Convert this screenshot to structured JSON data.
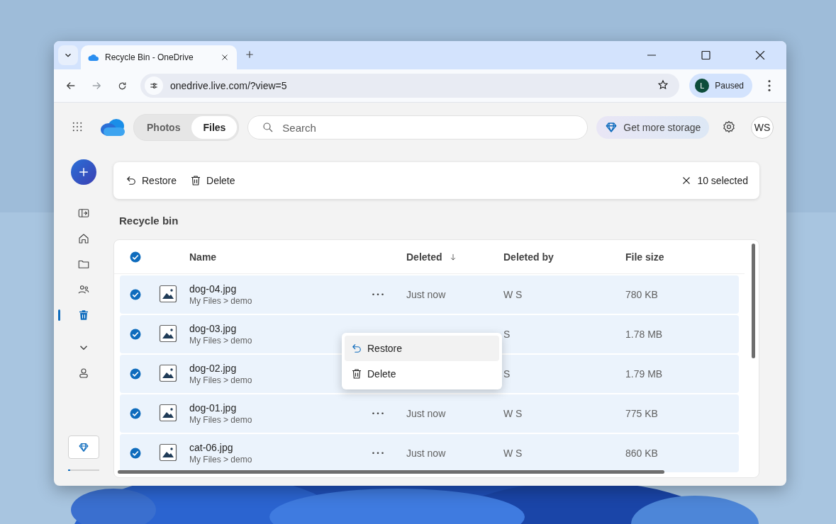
{
  "browser": {
    "tab": {
      "title": "Recycle Bin - OneDrive",
      "selected": true
    },
    "address": "onedrive.live.com/?view=5",
    "profile": {
      "initial": "L",
      "label": "Paused"
    }
  },
  "header": {
    "switcher": [
      {
        "label": "Photos",
        "selected": false
      },
      {
        "label": "Files",
        "selected": true
      }
    ],
    "search": {
      "placeholder": "Search"
    },
    "storage_button": "Get more storage",
    "avatar": "WS"
  },
  "sidebar": {
    "items": [
      {
        "kind": "panel",
        "selected": false
      },
      {
        "kind": "home",
        "selected": false
      },
      {
        "kind": "folder",
        "selected": false
      },
      {
        "kind": "people",
        "selected": false
      },
      {
        "kind": "trash",
        "selected": true
      },
      {
        "kind": "expand",
        "selected": false
      },
      {
        "kind": "person",
        "selected": false
      }
    ]
  },
  "toolbar": {
    "actions": [
      {
        "label": "Restore",
        "kind": "restore"
      },
      {
        "label": "Delete",
        "kind": "delete"
      }
    ],
    "selection": "10 selected"
  },
  "page_title": "Recycle bin",
  "table": {
    "all_selected": true,
    "columns": [
      {
        "label": "Name"
      },
      {
        "label": "Deleted",
        "sorted": true
      },
      {
        "label": "Deleted by"
      },
      {
        "label": "File size"
      }
    ],
    "rows": [
      {
        "name": "dog-04.jpg",
        "path": "My Files > demo",
        "deleted": "Just now",
        "deleted_by": "W S",
        "size": "780 KB",
        "selected": true
      },
      {
        "name": "dog-03.jpg",
        "path": "My Files > demo",
        "deleted_by": "S",
        "size": "1.78 MB",
        "selected": true
      },
      {
        "name": "dog-02.jpg",
        "path": "My Files > demo",
        "deleted_by": "S",
        "size": "1.79 MB",
        "selected": true
      },
      {
        "name": "dog-01.jpg",
        "path": "My Files > demo",
        "deleted": "Just now",
        "deleted_by": "W S",
        "size": "775 KB",
        "selected": true
      },
      {
        "name": "cat-06.jpg",
        "path": "My Files > demo",
        "deleted": "Just now",
        "deleted_by": "W S",
        "size": "860 KB",
        "selected": true
      }
    ]
  },
  "context_menu": {
    "items": [
      {
        "label": "Restore",
        "kind": "restore",
        "selected": true
      },
      {
        "label": "Delete",
        "kind": "delete",
        "selected": false
      }
    ]
  }
}
